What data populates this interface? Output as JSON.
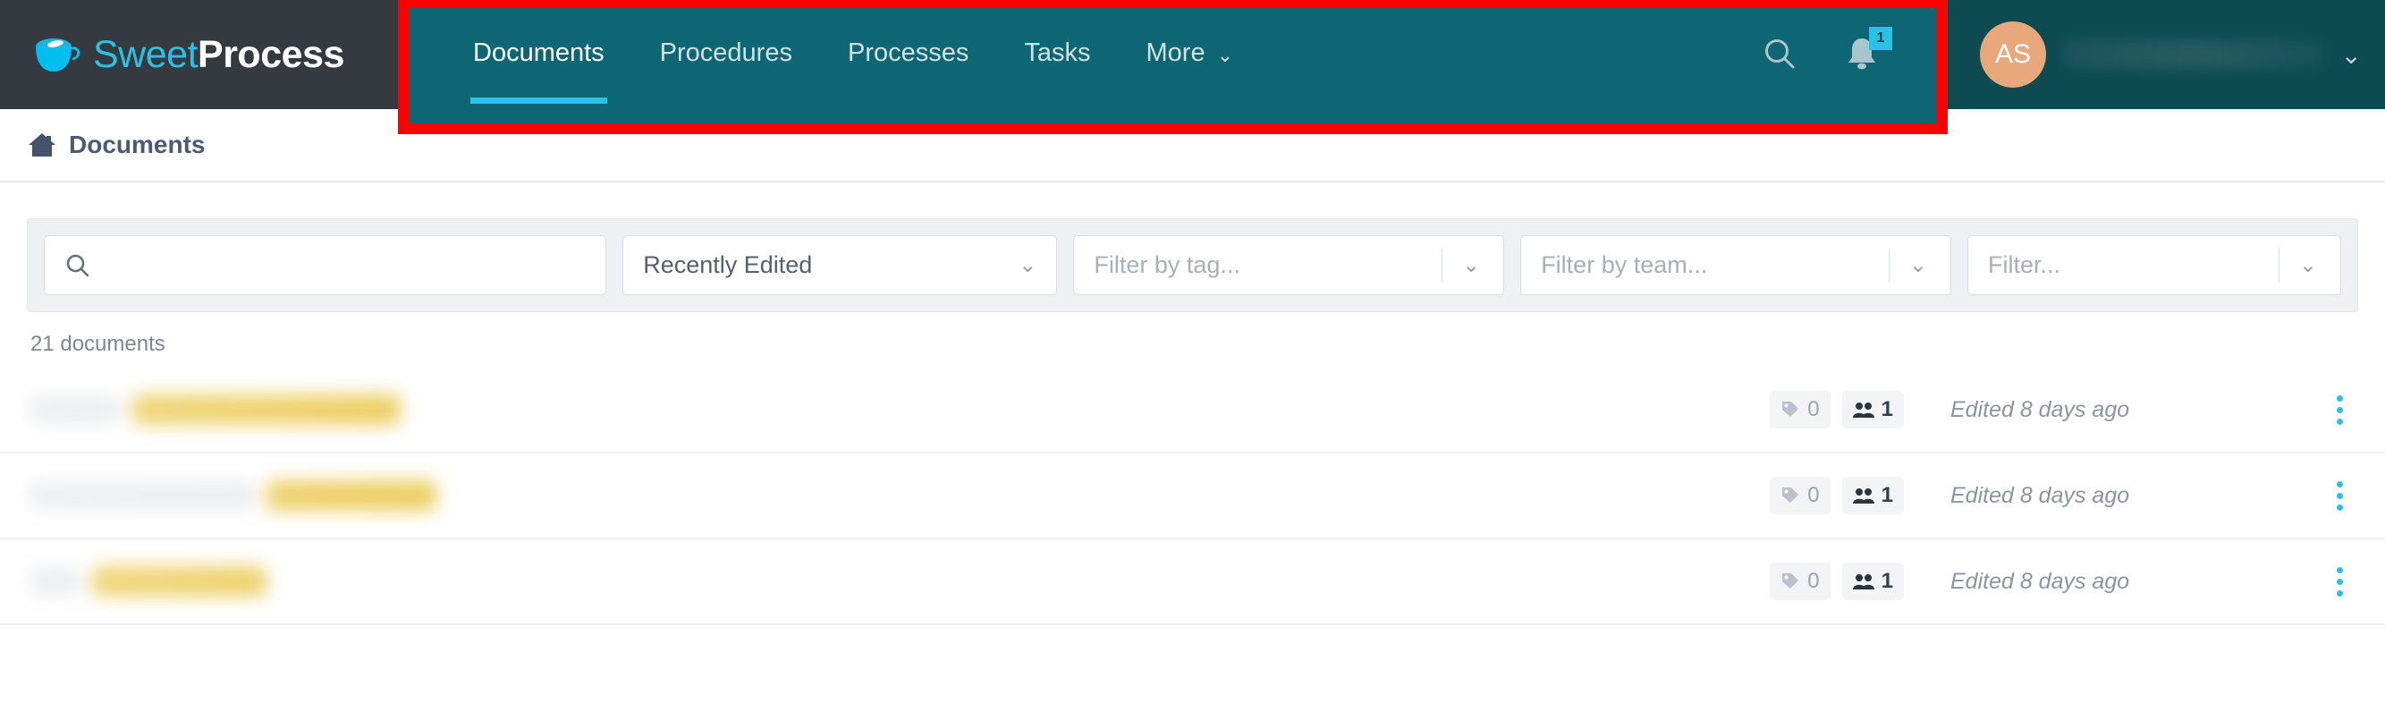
{
  "brand": {
    "sweet": "Sweet",
    "process": "Process",
    "cup_icon": "coffee-cup-icon"
  },
  "nav": {
    "items": [
      {
        "label": "Documents",
        "active": true
      },
      {
        "label": "Procedures",
        "active": false
      },
      {
        "label": "Processes",
        "active": false
      },
      {
        "label": "Tasks",
        "active": false
      },
      {
        "label": "More",
        "active": false,
        "caret": "⌄"
      }
    ],
    "search_icon": "search-icon",
    "bell_icon": "bell-icon",
    "notification_count": "1",
    "highlight_color": "#ff0000",
    "nav_bg": "#0e6573",
    "active_underline_color": "#29c1e6"
  },
  "user": {
    "avatar_initials": "AS",
    "avatar_color": "#e8a87c",
    "name": "",
    "caret": "⌄"
  },
  "breadcrumb": {
    "home_icon": "home-icon",
    "label": "Documents"
  },
  "filters": {
    "search": {
      "icon": "search-icon",
      "value": "",
      "placeholder": ""
    },
    "sort": {
      "value": "Recently Edited",
      "caret": "⌄"
    },
    "tag": {
      "placeholder": "Filter by tag...",
      "caret": "⌄"
    },
    "team": {
      "placeholder": "Filter by team...",
      "caret": "⌄"
    },
    "other": {
      "placeholder": "Filter...",
      "caret": "⌄"
    }
  },
  "list": {
    "count_label": "21 documents",
    "rows": [
      {
        "tag_icon": "tag-icon",
        "tags": "0",
        "team_icon": "team-icon",
        "teams": "1",
        "edited": "Edited 8 days ago",
        "menu_icon": "kebab-menu-icon"
      },
      {
        "tag_icon": "tag-icon",
        "tags": "0",
        "team_icon": "team-icon",
        "teams": "1",
        "edited": "Edited 8 days ago",
        "menu_icon": "kebab-menu-icon"
      },
      {
        "tag_icon": "tag-icon",
        "tags": "0",
        "team_icon": "team-icon",
        "teams": "1",
        "edited": "Edited 8 days ago",
        "menu_icon": "kebab-menu-icon"
      }
    ]
  }
}
